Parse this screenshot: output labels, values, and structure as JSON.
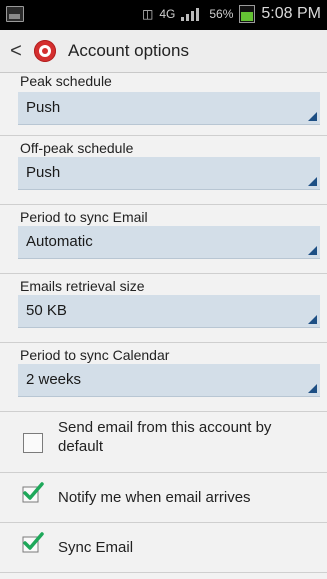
{
  "status_bar": {
    "battery_percent": "56%",
    "time": "5:08 PM"
  },
  "header": {
    "title": "Account options"
  },
  "settings": [
    {
      "label": "Peak schedule",
      "value": "Push"
    },
    {
      "label": "Off-peak schedule",
      "value": "Push"
    },
    {
      "label": "Period to sync Email",
      "value": "Automatic"
    },
    {
      "label": "Emails retrieval size",
      "value": "50 KB"
    },
    {
      "label": "Period to sync Calendar",
      "value": "2 weeks"
    }
  ],
  "checkboxes": [
    {
      "label": "Send email from this account by default",
      "checked": false
    },
    {
      "label": "Notify me when email arrives",
      "checked": true
    },
    {
      "label": "Sync Email",
      "checked": true
    }
  ],
  "colors": {
    "dropdown_bg": "#d3dee8",
    "checkmark": "#1ea85a",
    "accent": "#1d4f84"
  }
}
